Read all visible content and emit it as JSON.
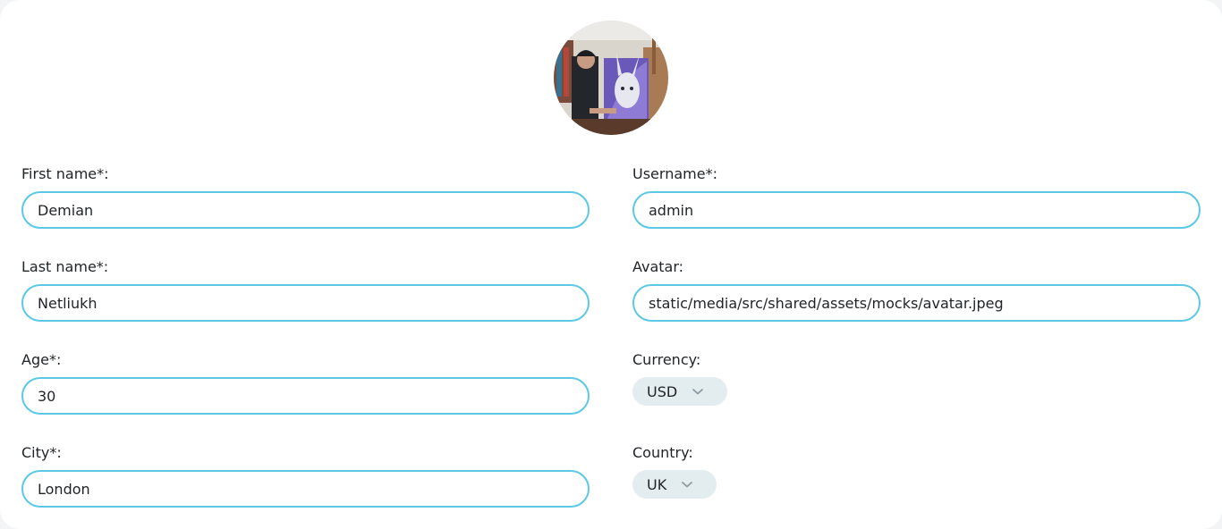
{
  "avatar": {
    "icon": "user-avatar-photo"
  },
  "form": {
    "first_name": {
      "label": "First name*:",
      "value": "Demian"
    },
    "last_name": {
      "label": "Last name*:",
      "value": "Netliukh"
    },
    "age": {
      "label": "Age*:",
      "value": "30"
    },
    "city": {
      "label": "City*:",
      "value": "London"
    },
    "username": {
      "label": "Username*:",
      "value": "admin"
    },
    "avatar_path": {
      "label": "Avatar:",
      "value": "static/media/src/shared/assets/mocks/avatar.jpeg"
    },
    "currency": {
      "label": "Currency:",
      "selected": "USD"
    },
    "country": {
      "label": "Country:",
      "selected": "UK"
    }
  },
  "colors": {
    "input_border": "#5bc8e6",
    "select_bg": "#e3ecef",
    "text": "#1f2328"
  }
}
